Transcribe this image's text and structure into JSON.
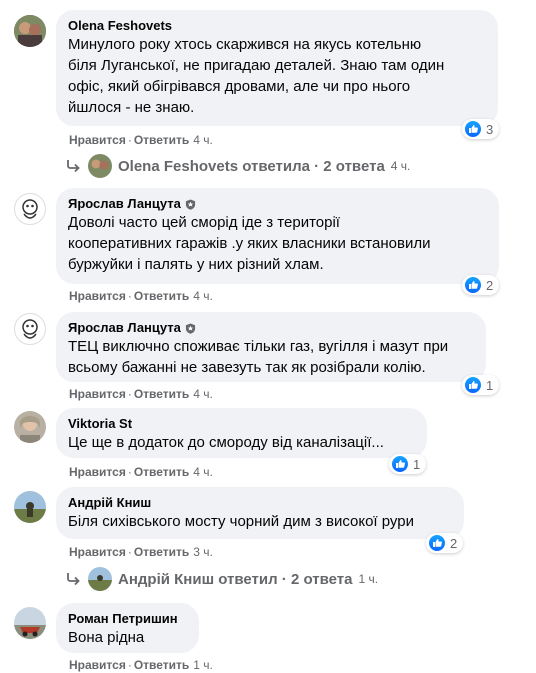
{
  "comments": [
    {
      "author": "Olena Feshovets",
      "lines": [
        "Минулого року хтось скаржився на якусь котельню",
        "біля Луганської, не пригадаю деталей. Знаю там один",
        "офіс, який обігрівався дровами, але чи про нього",
        "йшлося - не знаю."
      ],
      "like": "Нравится",
      "reply": "Ответить",
      "time": "4 ч.",
      "reactions": "3",
      "replies": {
        "label": "Olena Feshovets ответила · 2 ответа",
        "time": "4 ч."
      }
    },
    {
      "author": "Ярослав Ланцута",
      "lines": [
        "Доволі часто цей сморід іде з території",
        "кооперативних гаражів .у яких власники встановили",
        "буржуйки і палять у них різний хлам."
      ],
      "like": "Нравится",
      "reply": "Ответить",
      "time": "4 ч.",
      "reactions": "2"
    },
    {
      "author": "Ярослав Ланцута",
      "lines": [
        "ТЕЦ виключно споживає тільки газ, вугілля і мазут при",
        "всьому бажанні не завезуть так як розібрали колію."
      ],
      "like": "Нравится",
      "reply": "Ответить",
      "time": "4 ч.",
      "reactions": "1"
    },
    {
      "author": "Viktoria St",
      "lines": [
        "Це ще в додаток до смороду від каналізації..."
      ],
      "like": "Нравится",
      "reply": "Ответить",
      "time": "4 ч.",
      "reactions": "1"
    },
    {
      "author": "Андрій Книш",
      "lines": [
        "Біля сихівського мосту чорний дим з високої рури"
      ],
      "like": "Нравится",
      "reply": "Ответить",
      "time": "3 ч.",
      "reactions": "2",
      "replies": {
        "label": "Андрій Книш ответил · 2 ответа",
        "time": "1 ч."
      }
    },
    {
      "author": "Роман Петришин",
      "lines": [
        "Вона рідна"
      ],
      "like": "Нравится",
      "reply": "Ответить",
      "time": "1 ч."
    }
  ],
  "colors": {
    "bubble": "#f0f2f5",
    "meta": "#65676b",
    "like": "#0866ff"
  },
  "icons": {
    "reply": "reply-arrow-icon",
    "like": "like-reaction-icon",
    "badge": "top-fan-badge-icon"
  }
}
